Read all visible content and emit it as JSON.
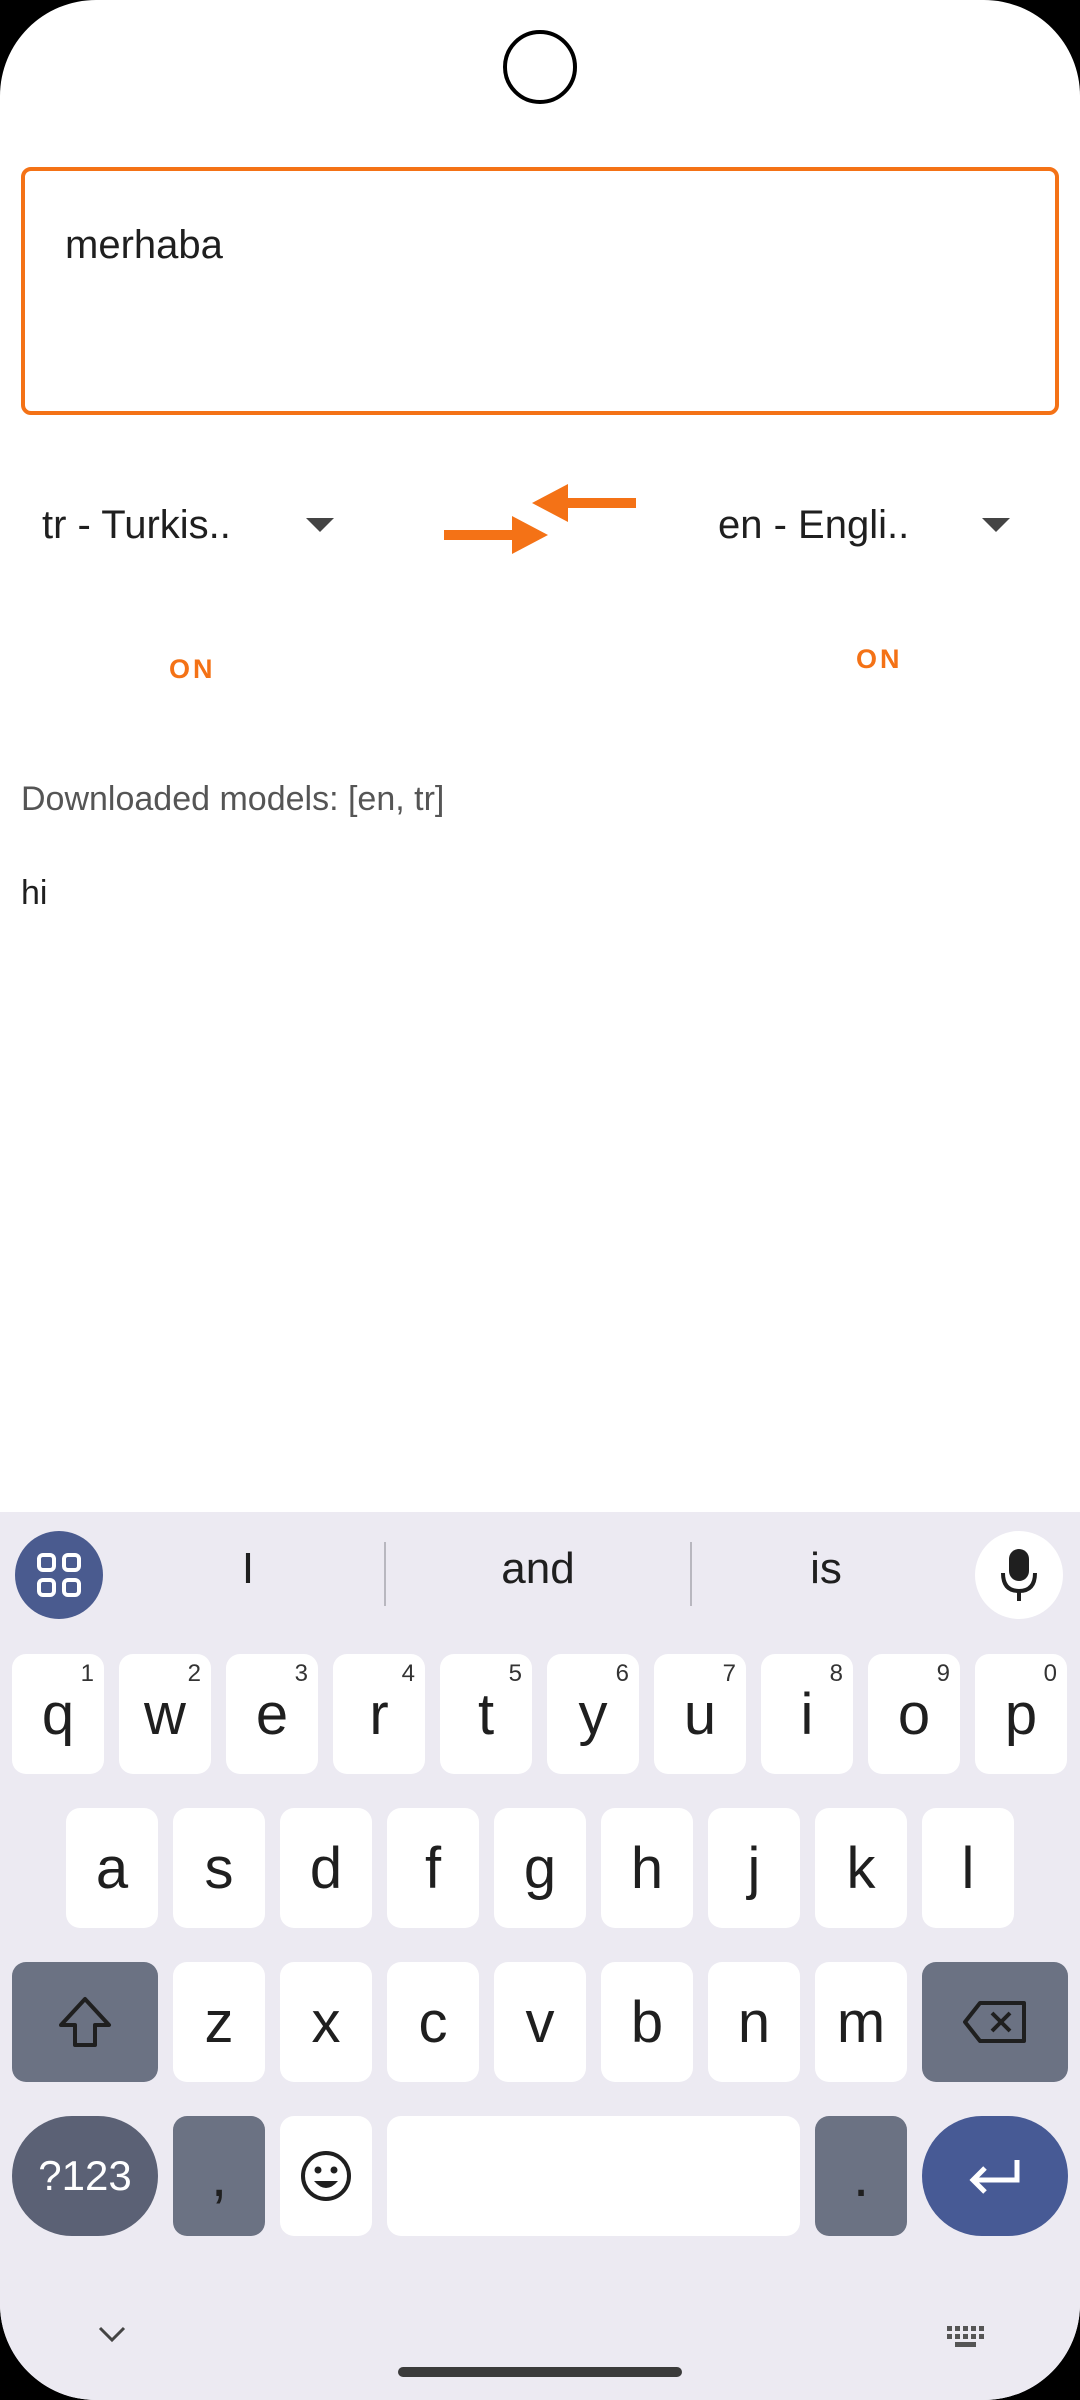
{
  "input": {
    "value": "merhaba"
  },
  "languages": {
    "source": "tr - Turkis..",
    "target": "en - Engli..",
    "source_toggle": "ON",
    "target_toggle": "ON"
  },
  "status": {
    "downloaded_models": "Downloaded models: [en, tr]"
  },
  "result": {
    "text": "hi"
  },
  "accent_color": "#f47216",
  "keyboard": {
    "suggestions": [
      "I",
      "and",
      "is"
    ],
    "row1": [
      {
        "k": "q",
        "n": "1"
      },
      {
        "k": "w",
        "n": "2"
      },
      {
        "k": "e",
        "n": "3"
      },
      {
        "k": "r",
        "n": "4"
      },
      {
        "k": "t",
        "n": "5"
      },
      {
        "k": "y",
        "n": "6"
      },
      {
        "k": "u",
        "n": "7"
      },
      {
        "k": "i",
        "n": "8"
      },
      {
        "k": "o",
        "n": "9"
      },
      {
        "k": "p",
        "n": "0"
      }
    ],
    "row2": [
      "a",
      "s",
      "d",
      "f",
      "g",
      "h",
      "j",
      "k",
      "l"
    ],
    "row3": [
      "z",
      "x",
      "c",
      "v",
      "b",
      "n",
      "m"
    ],
    "symbols_label": "?123",
    "comma": ",",
    "period": ".",
    "icons": [
      "apps-grid-icon",
      "microphone-icon",
      "shift-icon",
      "backspace-icon",
      "emoji-icon",
      "enter-icon",
      "chevron-down-icon",
      "keyboard-icon"
    ]
  }
}
